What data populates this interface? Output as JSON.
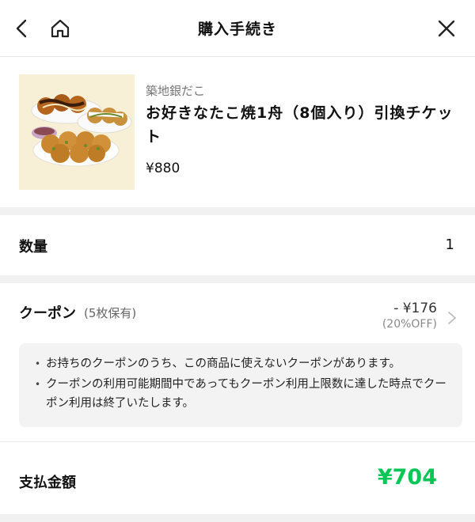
{
  "header": {
    "title": "購入手続き",
    "back_icon": "chevron-left-icon",
    "home_icon": "home-icon",
    "close_icon": "close-icon"
  },
  "product": {
    "shop": "築地銀だこ",
    "name": "お好きなたこ焼1舟（8個入り）引換チケット",
    "price": "¥880",
    "image_icon": "takoyaki-image"
  },
  "quantity": {
    "label": "数量",
    "value": "1"
  },
  "coupon": {
    "label": "クーポン",
    "count": "(5枚保有)",
    "discount": "- ¥176",
    "percent": "(20%OFF)",
    "chevron_icon": "chevron-right-icon",
    "notes": [
      "お持ちのクーポンのうち、この商品に使えないクーポンがあります。",
      "クーポンの利用可能期間中であってもクーポン利用上限数に達した時点でクーポン利用は終了いたします。"
    ]
  },
  "total": {
    "label": "支払金額",
    "value": "¥704"
  },
  "colors": {
    "accent": "#06c755",
    "background": "#ffffff",
    "section_gap": "#f1f1f1",
    "notice_bg": "#f3f3f3"
  }
}
